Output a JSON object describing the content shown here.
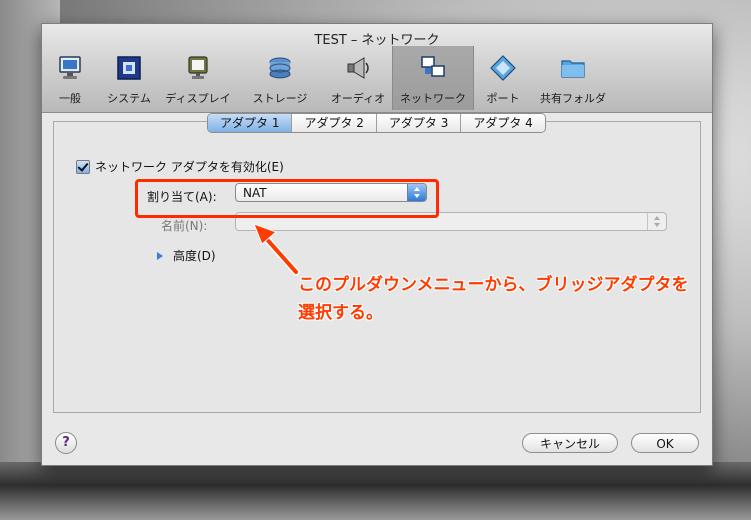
{
  "window": {
    "title": "TEST – ネットワーク"
  },
  "toolbar": {
    "items": [
      {
        "label": "一般",
        "icon": "monitor-icon"
      },
      {
        "label": "システム",
        "icon": "chip-icon"
      },
      {
        "label": "ディスプレイ",
        "icon": "display-icon"
      },
      {
        "label": "ストレージ",
        "icon": "disk-icon"
      },
      {
        "label": "オーディオ",
        "icon": "speaker-icon"
      },
      {
        "label": "ネットワーク",
        "icon": "network-icon"
      },
      {
        "label": "ポート",
        "icon": "port-icon"
      },
      {
        "label": "共有フォルダ",
        "icon": "folder-icon"
      }
    ],
    "active": "ネットワーク"
  },
  "tabs": [
    {
      "label": "アダプタ 1"
    },
    {
      "label": "アダプタ 2"
    },
    {
      "label": "アダプタ 3"
    },
    {
      "label": "アダプタ 4"
    }
  ],
  "form": {
    "enable_label": "ネットワーク アダプタを有効化(E)",
    "enable_checked": true,
    "attach_label": "割り当て(A):",
    "attach_value": "NAT",
    "name_label": "名前(N):",
    "name_value": "",
    "advanced_label": "高度(D)"
  },
  "buttons": {
    "help": "?",
    "cancel": "キャンセル",
    "ok": "OK"
  },
  "annotation": {
    "line1": "このプルダウンメニューから、ブリッジアダプタを",
    "line2": "選択する。",
    "color": "#ff3b00"
  }
}
